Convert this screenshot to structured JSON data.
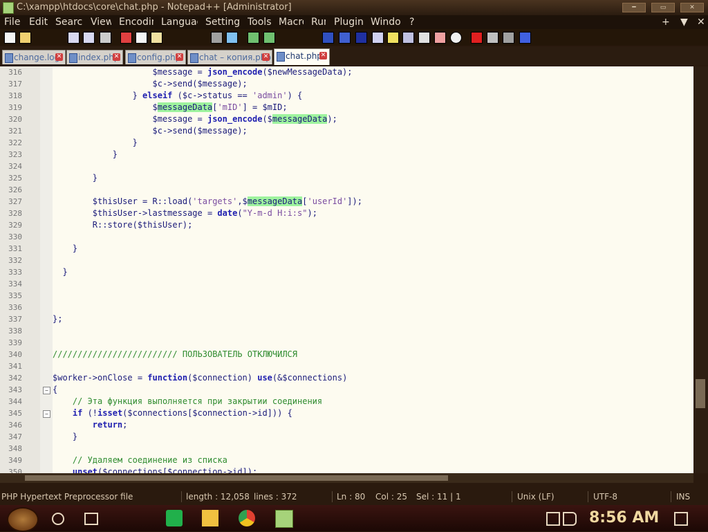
{
  "window": {
    "title": "C:\\xampp\\htdocs\\core\\chat.php - Notepad++ [Administrator]",
    "controls": [
      "min",
      "max",
      "close"
    ]
  },
  "menubar": {
    "items": [
      "File",
      "Edit",
      "Search",
      "View",
      "Encoding",
      "Language",
      "Settings",
      "Tools",
      "Macro",
      "Run",
      "Plugins",
      "Window",
      "?"
    ],
    "right": [
      "+",
      "▼",
      "✕"
    ]
  },
  "tabs": [
    {
      "label": "change.log",
      "active": false
    },
    {
      "label": "index.php",
      "active": false
    },
    {
      "label": "config.php",
      "active": false
    },
    {
      "label": "chat – копия.php",
      "active": false
    },
    {
      "label": "chat.php",
      "active": true
    }
  ],
  "editor": {
    "lines": [
      {
        "n": "316",
        "text": "                    $message = json_encode($newMessageData);"
      },
      {
        "n": "317",
        "text": "                    $c->send($message);"
      },
      {
        "n": "318",
        "text": "                } elseif ($c->status == 'admin') {"
      },
      {
        "n": "319",
        "text": "                    $messageData['mID'] = $mID;"
      },
      {
        "n": "320",
        "text": "                    $message = json_encode($messageData);"
      },
      {
        "n": "321",
        "text": "                    $c->send($message);"
      },
      {
        "n": "322",
        "text": "                }"
      },
      {
        "n": "323",
        "text": "            }"
      },
      {
        "n": "324",
        "text": ""
      },
      {
        "n": "325",
        "text": "        }"
      },
      {
        "n": "326",
        "text": ""
      },
      {
        "n": "327",
        "text": "        $thisUser = R::load('targets',$messageData['userId']);"
      },
      {
        "n": "328",
        "text": "        $thisUser->lastmessage = date(\"Y-m-d H:i:s\");"
      },
      {
        "n": "329",
        "text": "        R::store($thisUser);"
      },
      {
        "n": "330",
        "text": ""
      },
      {
        "n": "331",
        "text": "    }"
      },
      {
        "n": "332",
        "text": ""
      },
      {
        "n": "333",
        "text": "  }"
      },
      {
        "n": "334",
        "text": ""
      },
      {
        "n": "335",
        "text": ""
      },
      {
        "n": "336",
        "text": ""
      },
      {
        "n": "337",
        "text": "};"
      },
      {
        "n": "338",
        "text": ""
      },
      {
        "n": "339",
        "text": ""
      },
      {
        "n": "340",
        "text": "///////////////////////// ПОЛЬЗОВАТЕЛЬ ОТКЛЮЧИЛСЯ"
      },
      {
        "n": "341",
        "text": ""
      },
      {
        "n": "342",
        "text": "$worker->onClose = function($connection) use(&$connections)"
      },
      {
        "n": "343",
        "text": "{"
      },
      {
        "n": "344",
        "text": "    // Эта функция выполняется при закрытии соединения"
      },
      {
        "n": "345",
        "text": "    if (!isset($connections[$connection->id])) {"
      },
      {
        "n": "346",
        "text": "        return;"
      },
      {
        "n": "347",
        "text": "    }"
      },
      {
        "n": "348",
        "text": ""
      },
      {
        "n": "349",
        "text": "    // Удаляем соединение из списка"
      },
      {
        "n": "350",
        "text": "    unset($connections[$connection->id]);"
      }
    ]
  },
  "statusbar": {
    "filetype": "PHP Hypertext Preprocessor file",
    "length": "length : 12,058",
    "lines": "lines : 372",
    "ln": "Ln : 80",
    "col": "Col : 25",
    "sel": "Sel : 11 | 1",
    "eol": "Unix (LF)",
    "encoding": "UTF-8",
    "mode": "INS"
  },
  "taskbar": {
    "clock": "8:56 AM"
  },
  "colors": {
    "highlight": "#9ef39e",
    "keyword": "#2020b0",
    "comment": "#2e8b2e",
    "editor_bg": "#fdfbf0"
  }
}
